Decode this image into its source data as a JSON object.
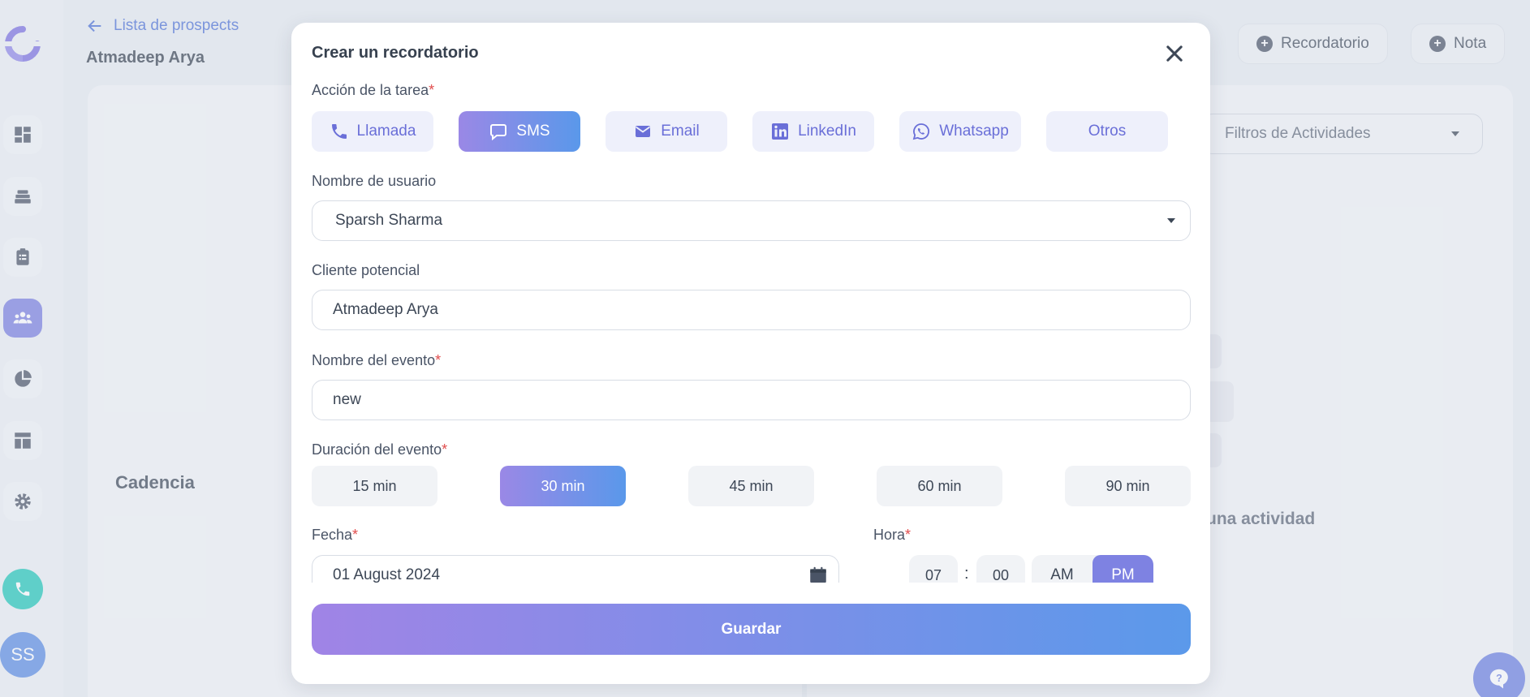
{
  "header": {
    "back_label": "Lista de prospects",
    "prospect_name": "Atmadeep Arya",
    "btn_reminder": "Recordatorio",
    "btn_note": "Nota"
  },
  "background": {
    "section_cadence": "Cadencia",
    "activity_filter": "Filtros de Actividades",
    "activity_text": "una actividad"
  },
  "sidebar": {
    "avatar_initials": "SS",
    "items": [
      "dashboard-icon",
      "layers-icon",
      "clipboard-icon",
      "users-icon",
      "pie-chart-icon",
      "layout-icon",
      "gear-icon"
    ],
    "active_index": 3
  },
  "modal": {
    "title": "Crear un recordatorio",
    "task_action_label": "Acción de la tarea",
    "required_mark": "*",
    "actions": [
      {
        "label": "Llamada",
        "icon": "phone-icon"
      },
      {
        "label": "SMS",
        "icon": "chat-icon",
        "selected": true
      },
      {
        "label": "Email",
        "icon": "email-icon"
      },
      {
        "label": "LinkedIn",
        "icon": "linkedin-icon"
      },
      {
        "label": "Whatsapp",
        "icon": "whatsapp-icon"
      },
      {
        "label": "Otros",
        "icon": ""
      }
    ],
    "username_label": "Nombre de usuario",
    "username_value": "Sparsh Sharma",
    "lead_label": "Cliente potencial",
    "lead_value": "Atmadeep Arya",
    "event_name_label": "Nombre del evento",
    "event_name_value": "new",
    "duration_label": "Duración del evento",
    "durations": [
      "15 min",
      "30 min",
      "45 min",
      "60 min",
      "90 min"
    ],
    "selected_duration": "30 min",
    "date_label": "Fecha",
    "date_value": "01 August 2024",
    "time_label": "Hora",
    "hour": "07",
    "minute": "00",
    "time_separator": ":",
    "am": "AM",
    "pm": "PM",
    "meridiem_selected": "PM",
    "save_label": "Guardar"
  },
  "colors": {
    "accent_gradient_start": "#9a88e6",
    "accent_gradient_end": "#5a98ea",
    "link_blue": "#4a6fd6",
    "required_red": "#e14c4c"
  }
}
